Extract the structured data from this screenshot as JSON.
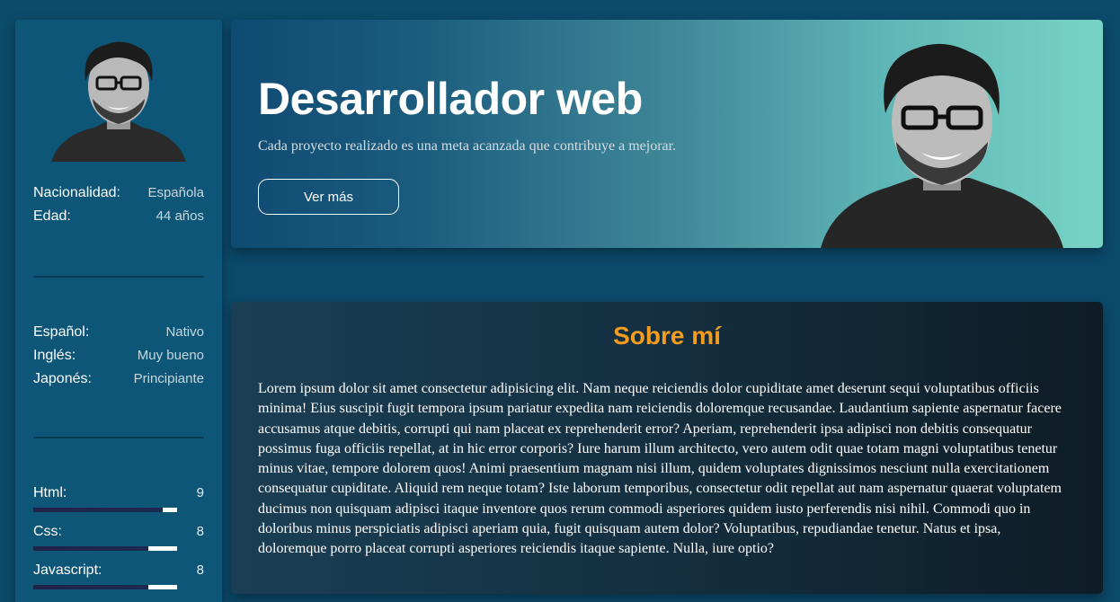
{
  "sidebar": {
    "personal": [
      {
        "label": "Nacionalidad:",
        "value": "Española"
      },
      {
        "label": "Edad:",
        "value": "44 años"
      }
    ],
    "languages": [
      {
        "label": "Español:",
        "value": "Nativo"
      },
      {
        "label": "Inglés:",
        "value": "Muy bueno"
      },
      {
        "label": "Japonés:",
        "value": "Principiante"
      }
    ],
    "skills": [
      {
        "label": "Html:",
        "value": "9",
        "level": 0.9
      },
      {
        "label": "Css:",
        "value": "8",
        "level": 0.8
      },
      {
        "label": "Javascript:",
        "value": "8",
        "level": 0.8
      }
    ]
  },
  "hero": {
    "title": "Desarrollador web",
    "subtitle": "Cada proyecto realizado es una meta acanzada que contribuye a mejorar.",
    "button_label": "Ver más"
  },
  "about": {
    "title": "Sobre mí",
    "text": "Lorem ipsum dolor sit amet consectetur adipisicing elit. Nam neque reiciendis dolor cupiditate amet deserunt sequi voluptatibus officiis minima! Eius suscipit fugit tempora ipsum pariatur expedita nam reiciendis doloremque recusandae. Laudantium sapiente aspernatur facere accusamus atque debitis, corrupti qui nam placeat ex reprehenderit error? Aperiam, reprehenderit ipsa adipisci non debitis consequatur possimus fuga officiis repellat, at in hic error corporis? Iure harum illum architecto, vero autem odit quae totam magni voluptatibus tenetur minus vitae, tempore dolorem quos! Animi praesentium magnam nisi illum, quidem voluptates dignissimos nesciunt nulla exercitationem consequatur cupiditate. Aliquid rem neque totam? Iste laborum temporibus, consectetur odit repellat aut nam aspernatur quaerat voluptatem ducimus non quisquam adipisci itaque inventore quos rerum commodi asperiores quidem iusto perferendis nisi nihil. Commodi quo in doloribus minus perspiciatis adipisci aperiam quia, fugit quisquam autem dolor? Voluptatibus, repudiandae tenetur. Natus et ipsa, doloremque porro placeat corrupti asperiores reiciendis itaque sapiente. Nulla, iure optio?"
  },
  "colors": {
    "page_bg": "#0c4a6b",
    "sidebar_bg": "#0e5677",
    "accent_orange": "#f39c1f"
  },
  "icons": {
    "sidebar_photo": "profile-photo",
    "hero_photo": "profile-photo"
  }
}
